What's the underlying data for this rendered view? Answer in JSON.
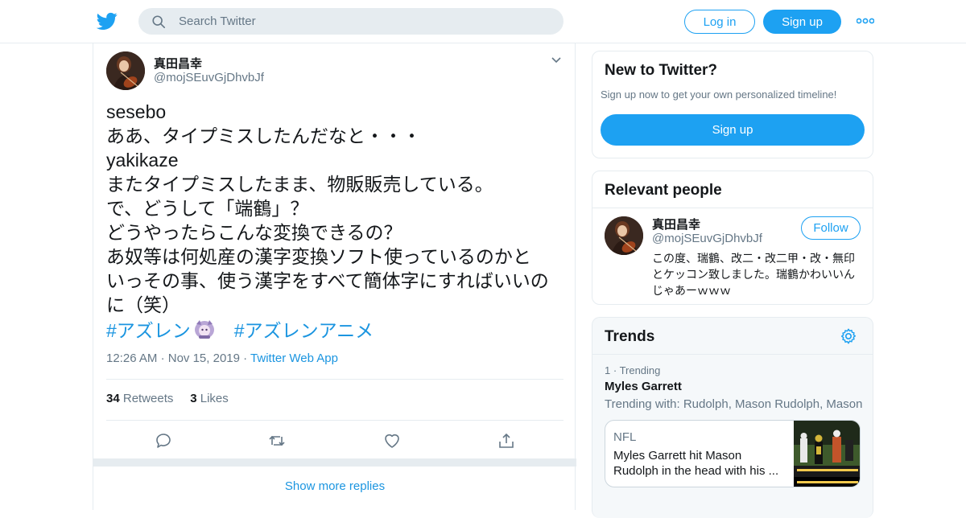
{
  "header": {
    "search_placeholder": "Search Twitter",
    "login_label": "Log in",
    "signup_label": "Sign up"
  },
  "tweet": {
    "display_name": "真田昌幸",
    "handle": "@mojSEuvGjDhvbJf",
    "lines": [
      "sesebo",
      "ああ、タイプミスしたんだなと・・・",
      "yakikaze",
      "またタイプミスしたまま、物販販売している。",
      "で、どうして「端鶴」？",
      "どうやったらこんな変換できるの？",
      "あ奴等は何処産の漢字変換ソフト使っているのかと",
      "いっその事、使う漢字をすべて簡体字にすればいいの",
      "に（笑）"
    ],
    "hashtag_1": "#アズレン",
    "hashtag_2": "#アズレンアニメ",
    "time": "12:26 AM",
    "date": "Nov 15, 2019",
    "source": "Twitter Web App",
    "retweets_count": "34",
    "retweets_label": "Retweets",
    "likes_count": "3",
    "likes_label": "Likes",
    "show_more": "Show more replies"
  },
  "new_to_twitter": {
    "title": "New to Twitter?",
    "subtitle": "Sign up now to get your own personalized timeline!",
    "signup_label": "Sign up"
  },
  "relevant_people": {
    "title": "Relevant people",
    "name": "真田昌幸",
    "handle": "@mojSEuvGjDhvbJf",
    "follow_label": "Follow",
    "bio": "この度、瑞鶴、改二・改二甲・改・無印とケッコン致しました。瑞鶴かわいいんじゃあーｗｗｗ"
  },
  "trends": {
    "title": "Trends",
    "rank": "1",
    "rank_label": "Trending",
    "name": "Myles Garrett",
    "with": "Trending with: Rudolph, Mason Rudolph, Mason",
    "news_category": "NFL",
    "news_headline": "Myles Garrett hit Mason Rudolph in the head with his ..."
  },
  "colors": {
    "accent": "#1da1f2",
    "link": "#1b95e0",
    "muted": "#657786",
    "border": "#e6ecf0"
  }
}
